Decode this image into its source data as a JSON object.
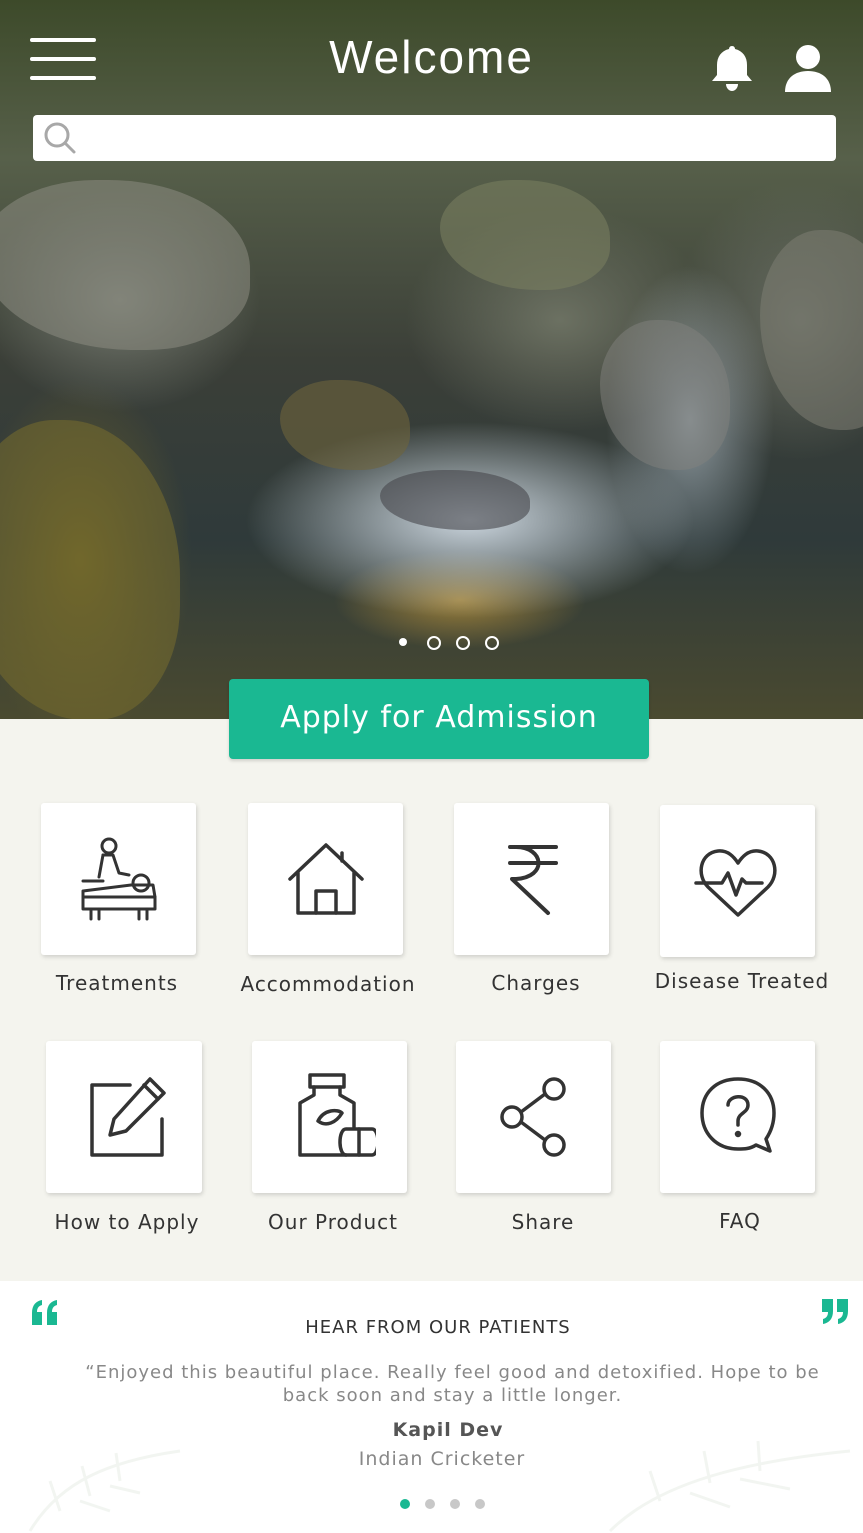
{
  "header": {
    "title": "Welcome",
    "menu_icon": "hamburger-menu-icon",
    "notification_icon": "bell-icon",
    "profile_icon": "user-icon"
  },
  "search": {
    "placeholder": "",
    "value": "",
    "icon": "search-icon"
  },
  "carousel": {
    "slide_count": 4,
    "active_index": 0
  },
  "apply_button": {
    "label": "Apply for Admission"
  },
  "menu": {
    "items": [
      {
        "label": "Treatments",
        "icon": "massage-treatment-icon"
      },
      {
        "label": "Accommodation",
        "icon": "house-icon"
      },
      {
        "label": "Charges",
        "icon": "rupee-icon"
      },
      {
        "label": "Disease Treated",
        "icon": "heart-pulse-icon"
      },
      {
        "label": "How to Apply",
        "icon": "edit-pencil-icon"
      },
      {
        "label": "Our Product",
        "icon": "medicine-bottle-icon"
      },
      {
        "label": "Share",
        "icon": "share-icon"
      },
      {
        "label": "FAQ",
        "icon": "question-bubble-icon"
      }
    ]
  },
  "testimonial": {
    "heading": "HEAR FROM OUR PATIENTS",
    "quote": "“Enjoyed this beautiful place. Really feel good and detoxified. Hope to be back soon and stay a little longer.",
    "name": "Kapil Dev",
    "role": "Indian Cricketer",
    "slide_count": 4,
    "active_index": 0,
    "open_quote_icon": "open-quote-icon",
    "close_quote_icon": "close-quote-icon"
  },
  "colors": {
    "accent": "#1ab892",
    "background": "#f4f4ee",
    "icon_stroke": "#333333"
  }
}
